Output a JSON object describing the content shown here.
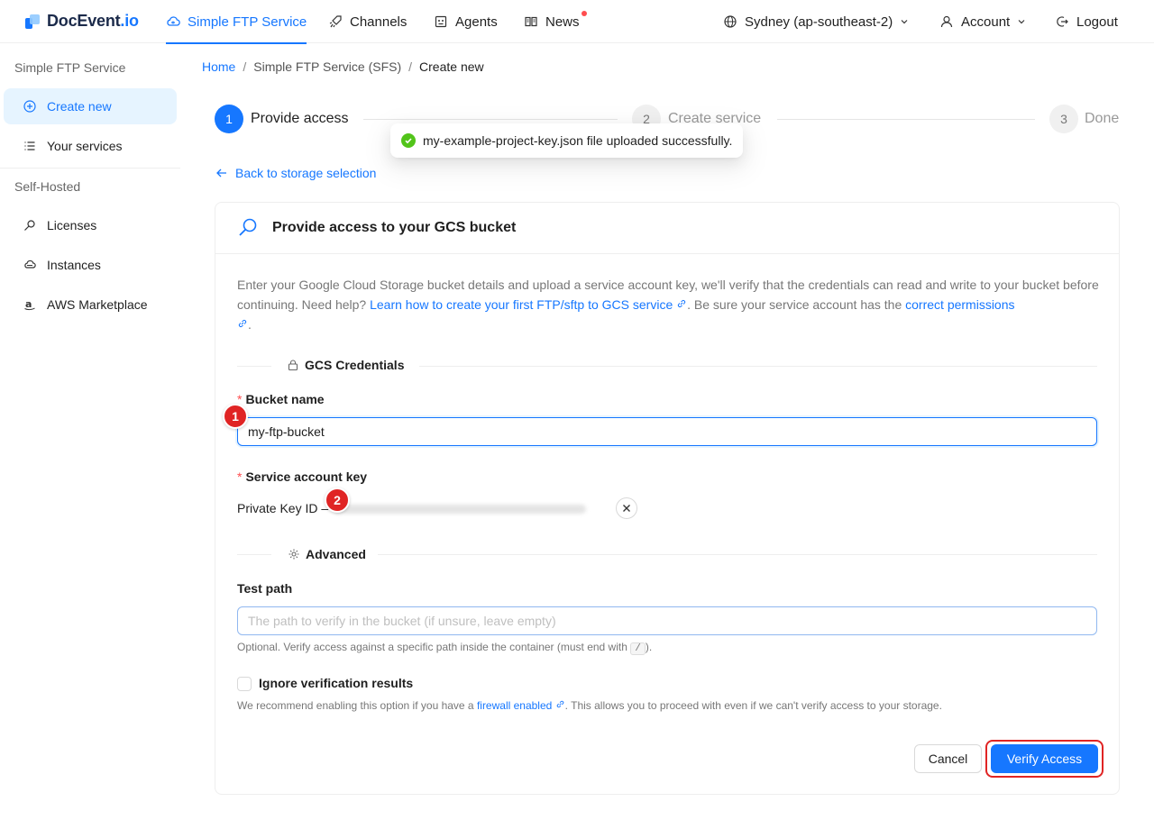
{
  "brand": {
    "name": "DocEvent",
    "suffix": ".io"
  },
  "nav": {
    "items": [
      {
        "label": "Simple FTP Service",
        "icon": "cloud-icon"
      },
      {
        "label": "Channels",
        "icon": "rocket-icon"
      },
      {
        "label": "Agents",
        "icon": "robot-icon"
      },
      {
        "label": "News",
        "icon": "book-icon"
      }
    ],
    "region": "Sydney (ap-southeast-2)",
    "account": "Account",
    "logout": "Logout"
  },
  "sidebar": {
    "group1": "Simple FTP Service",
    "items1": [
      {
        "label": "Create new",
        "icon": "plus-circle-icon"
      },
      {
        "label": "Your services",
        "icon": "list-icon"
      }
    ],
    "group2": "Self-Hosted",
    "items2": [
      {
        "label": "Licenses",
        "icon": "key-icon"
      },
      {
        "label": "Instances",
        "icon": "cloud-server-icon"
      },
      {
        "label": "AWS Marketplace",
        "icon": "amazon-icon"
      }
    ]
  },
  "breadcrumb": {
    "home": "Home",
    "parent": "Simple FTP Service (SFS)",
    "current": "Create new",
    "sep": "/"
  },
  "steps": [
    {
      "num": "1",
      "label": "Provide access"
    },
    {
      "num": "2",
      "label": "Create service"
    },
    {
      "num": "3",
      "label": "Done"
    }
  ],
  "toast": {
    "message": "my-example-project-key.json file uploaded successfully."
  },
  "back_link": "Back to storage selection",
  "card": {
    "title": "Provide access to your GCS bucket",
    "desc_1": "Enter your Google Cloud Storage bucket details and upload a service account key, we'll verify that the credentials can read and write to your bucket before continuing. Need help? ",
    "desc_link_1": "Learn how to create your first FTP/sftp to GCS service",
    "desc_2": ". Be sure your service account has the ",
    "desc_link_2": "correct permissions",
    "desc_3": "."
  },
  "credentials": {
    "section": "GCS Credentials",
    "bucket_label": "Bucket name",
    "bucket_value": "my-ftp-bucket",
    "key_label": "Service account key",
    "private_key_prefix": "Private Key ID –"
  },
  "advanced": {
    "section": "Advanced",
    "test_path_label": "Test path",
    "test_path_placeholder": "The path to verify in the bucket (if unsure, leave empty)",
    "hint_before": "Optional. Verify access against a specific path inside the container (must end with ",
    "hint_code": "/",
    "hint_after": ").",
    "ignore_label": "Ignore verification results",
    "ignore_hint_before": "We recommend enabling this option if you have a ",
    "ignore_hint_link": "firewall enabled",
    "ignore_hint_after": ". This allows you to proceed with even if we can't verify access to your storage."
  },
  "actions": {
    "cancel": "Cancel",
    "verify": "Verify Access"
  },
  "annotations": [
    "1",
    "2"
  ],
  "colors": {
    "primary": "#1677ff",
    "success": "#52c41a",
    "annotation": "#e02424"
  }
}
